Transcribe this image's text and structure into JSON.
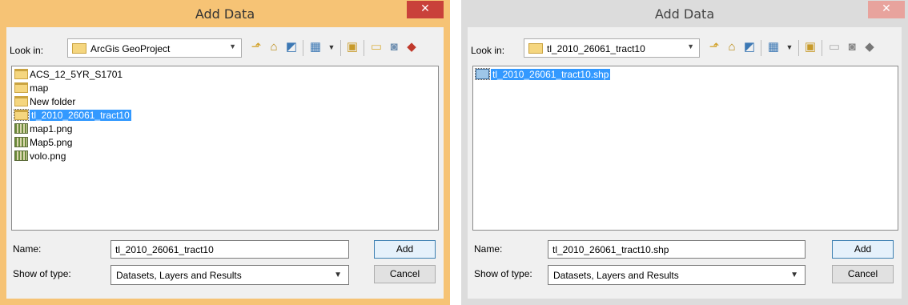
{
  "dialogs": [
    {
      "title": "Add Data",
      "close_glyph": "✕",
      "look_in_label": "Look in:",
      "look_in_value": "ArcGis GeoProject",
      "files": [
        {
          "name": "ACS_12_5YR_S1701",
          "icon": "folder-icon",
          "selected": false
        },
        {
          "name": "map",
          "icon": "folder-icon",
          "selected": false
        },
        {
          "name": "New folder",
          "icon": "folder-icon",
          "selected": false
        },
        {
          "name": "tl_2010_26061_tract10",
          "icon": "folder-icon",
          "selected": true
        },
        {
          "name": "map1.png",
          "icon": "raster-icon",
          "selected": false
        },
        {
          "name": "Map5.png",
          "icon": "raster-icon",
          "selected": false
        },
        {
          "name": "volo.png",
          "icon": "raster-icon",
          "selected": false
        }
      ],
      "name_label": "Name:",
      "name_value": "tl_2010_26061_tract10",
      "type_label": "Show of type:",
      "type_value": "Datasets, Layers and Results",
      "add_label": "Add",
      "cancel_label": "Cancel"
    },
    {
      "title": "Add Data",
      "close_glyph": "✕",
      "look_in_label": "Look in:",
      "look_in_value": "tl_2010_26061_tract10",
      "files": [
        {
          "name": "tl_2010_26061_tract10.shp",
          "icon": "shapefile-icon",
          "selected": true
        }
      ],
      "name_label": "Name:",
      "name_value": "tl_2010_26061_tract10.shp",
      "type_label": "Show of type:",
      "type_value": "Datasets, Layers and Results",
      "add_label": "Add",
      "cancel_label": "Cancel"
    }
  ],
  "toolbar_icons": [
    "up-one-level-icon",
    "home-icon",
    "connect-folder-icon",
    "view-list-icon",
    "new-folder-icon",
    "folder-icon",
    "database-icon",
    "toolbox-icon"
  ],
  "colors": {
    "active_frame": "#f6c375",
    "inactive_frame": "#dcdcdc",
    "close_active": "#c9413a",
    "selection": "#3399ff"
  }
}
